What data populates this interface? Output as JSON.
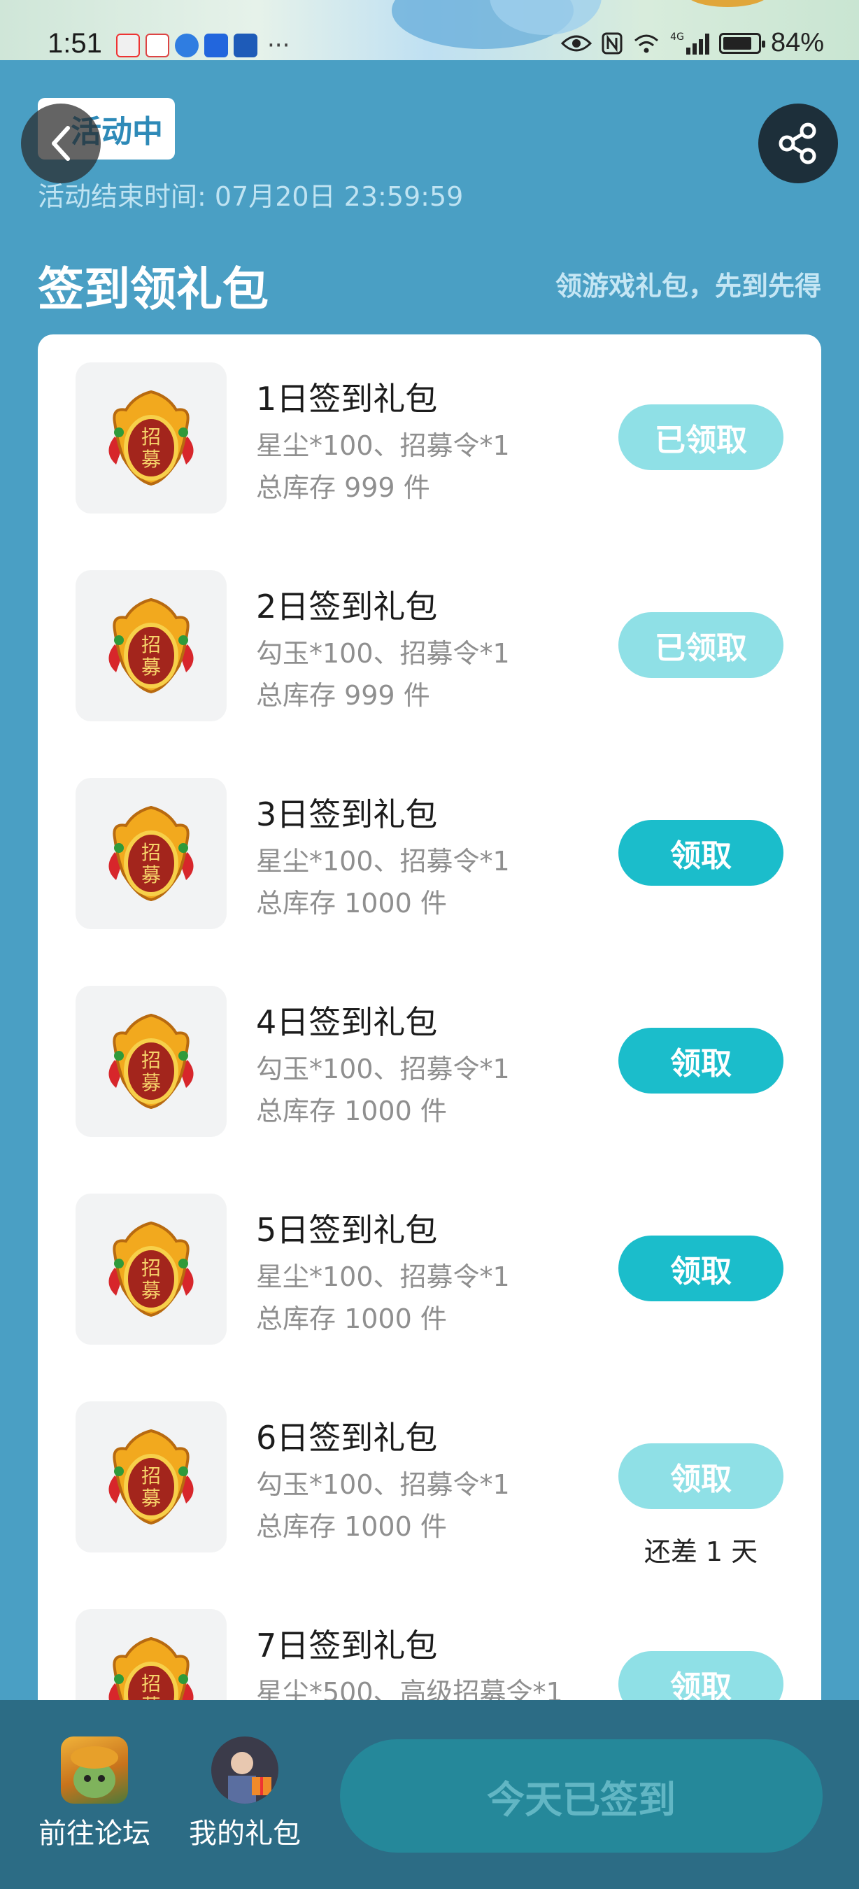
{
  "status_bar": {
    "time": "1:51",
    "battery_percent": "84%",
    "battery_level": 0.84,
    "more_indicator": "···",
    "network_label": "4G"
  },
  "header": {
    "status_chip": "活动中",
    "end_time": "活动结束时间: 07月20日 23:59:59",
    "back_icon": "chevron-left-icon",
    "share_icon": "share-icon"
  },
  "section": {
    "title": "签到领礼包",
    "subtitle": "领游戏礼包，先到先得"
  },
  "gifts": [
    {
      "name": "1日签到礼包",
      "desc": "星尘*100、招募令*1",
      "stock": "总库存 999 件",
      "button": "已领取",
      "button_state": "faded",
      "note": ""
    },
    {
      "name": "2日签到礼包",
      "desc": "勾玉*100、招募令*1",
      "stock": "总库存 999 件",
      "button": "已领取",
      "button_state": "faded",
      "note": ""
    },
    {
      "name": "3日签到礼包",
      "desc": "星尘*100、招募令*1",
      "stock": "总库存 1000 件",
      "button": "领取",
      "button_state": "active",
      "note": ""
    },
    {
      "name": "4日签到礼包",
      "desc": "勾玉*100、招募令*1",
      "stock": "总库存 1000 件",
      "button": "领取",
      "button_state": "active",
      "note": ""
    },
    {
      "name": "5日签到礼包",
      "desc": "星尘*100、招募令*1",
      "stock": "总库存 1000 件",
      "button": "领取",
      "button_state": "active",
      "note": ""
    },
    {
      "name": "6日签到礼包",
      "desc": "勾玉*100、招募令*1",
      "stock": "总库存 1000 件",
      "button": "领取",
      "button_state": "faded",
      "note": "还差 1 天"
    },
    {
      "name": "7日签到礼包",
      "desc": "星尘*500、高级招募令*1",
      "stock": "",
      "button": "领取",
      "button_state": "faded",
      "note": ""
    }
  ],
  "bottom_bar": {
    "forum_label": "前往论坛",
    "my_gifts_label": "我的礼包",
    "signin_label": "今天已签到"
  },
  "colors": {
    "page_bg": "#4a9fc4",
    "accent": "#1bbdcb",
    "accent_faded": "#8fe0e6",
    "bottom_bar": "#2c6c85"
  }
}
